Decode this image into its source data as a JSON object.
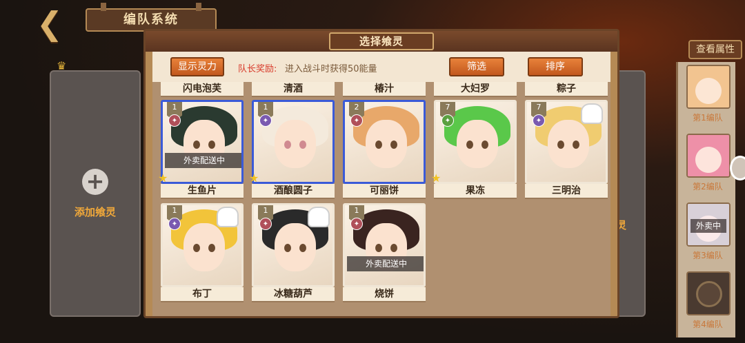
{
  "header": {
    "title": "编队系统",
    "back_icon": "back-arrow-icon"
  },
  "left_slot": {
    "add_label": "添加飨灵"
  },
  "right_partial_label": "灵",
  "view_attr": "查看属性",
  "teams": [
    {
      "label": "第1编队",
      "status": ""
    },
    {
      "label": "第2编队",
      "status": ""
    },
    {
      "label": "第3编队",
      "status": "外卖中"
    },
    {
      "label": "第4编队",
      "status": ""
    }
  ],
  "modal": {
    "title": "选择飨灵",
    "show_spirit_button": "显示灵力",
    "reward_label": "队长奖励:",
    "reward_text": "进入战斗时获得50能量",
    "filter_button": "筛选",
    "sort_button": "排序",
    "top_row_names": [
      "闪电泡芙",
      "清酒",
      "椿汁",
      "大妇罗",
      "粽子"
    ],
    "cards": [
      {
        "name": "生鱼片",
        "rank": "1",
        "selected": true,
        "star": true,
        "status": "外卖配送中",
        "chef": false,
        "elem": "red",
        "hair": "#2a3a30"
      },
      {
        "name": "酒酿圆子",
        "rank": "1",
        "selected": true,
        "star": true,
        "status": "",
        "chef": false,
        "elem": "purple",
        "hair": "#f4eadc"
      },
      {
        "name": "可丽饼",
        "rank": "2",
        "selected": true,
        "star": false,
        "status": "",
        "chef": false,
        "elem": "red",
        "hair": "#e8a86a"
      },
      {
        "name": "果冻",
        "rank": "7",
        "selected": false,
        "star": true,
        "status": "",
        "chef": false,
        "elem": "green",
        "hair": "#5ac84a"
      },
      {
        "name": "三明治",
        "rank": "7",
        "selected": false,
        "star": false,
        "status": "",
        "chef": true,
        "elem": "purple",
        "hair": "#f0cc70"
      },
      {
        "name": "布丁",
        "rank": "1",
        "selected": false,
        "star": false,
        "status": "",
        "chef": true,
        "elem": "purple",
        "hair": "#f2c43a"
      },
      {
        "name": "冰糖葫芦",
        "rank": "1",
        "selected": false,
        "star": false,
        "status": "",
        "chef": true,
        "elem": "red",
        "hair": "#2a2a2a"
      },
      {
        "name": "烧饼",
        "rank": "1",
        "selected": false,
        "star": false,
        "status": "外卖配送中",
        "chef": false,
        "elem": "red",
        "hair": "#3a2420"
      }
    ]
  }
}
